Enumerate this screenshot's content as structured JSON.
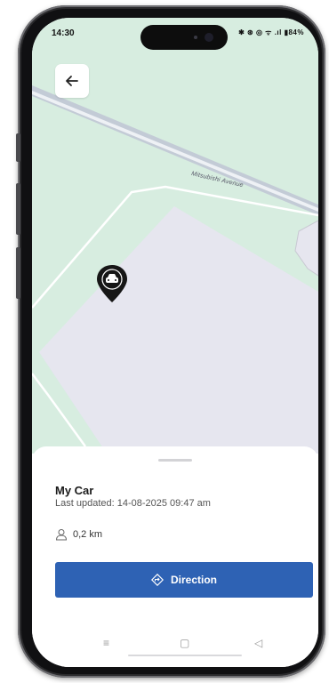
{
  "status_bar": {
    "time": "14:30",
    "icons_text": "✱ ⊛ ◎ ᯤ .ıl ▮84%"
  },
  "header": {
    "back_icon": "arrow-left-icon"
  },
  "map": {
    "street_name": "Mitsubishi Avenue",
    "marker_icon": "car-location-pin-icon"
  },
  "sheet": {
    "title": "My Car",
    "last_updated": "Last updated: 14-08-2025 09:47 am",
    "distance_icon": "person-icon",
    "distance": "0,2 km",
    "direction_icon": "diamond-arrow-icon",
    "direction_label": "Direction"
  },
  "nav_bar": {
    "menu": "≡",
    "home": "▢",
    "back": "◁"
  },
  "colors": {
    "primary": "#2e62b4",
    "map_background": "#d7ede0",
    "map_area": "#e6e6ef"
  }
}
